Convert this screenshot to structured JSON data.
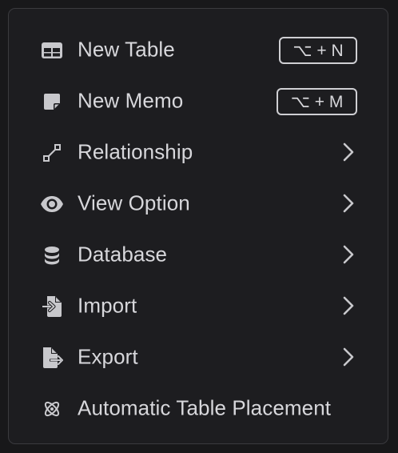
{
  "menu": {
    "items": [
      {
        "label": "New Table",
        "icon": "table-icon",
        "shortcut": "⌥ + N",
        "submenu": false
      },
      {
        "label": "New Memo",
        "icon": "memo-icon",
        "shortcut": "⌥ + M",
        "submenu": false
      },
      {
        "label": "Relationship",
        "icon": "relationship-icon",
        "shortcut": "",
        "submenu": true
      },
      {
        "label": "View Option",
        "icon": "eye-icon",
        "shortcut": "",
        "submenu": true
      },
      {
        "label": "Database",
        "icon": "database-icon",
        "shortcut": "",
        "submenu": true
      },
      {
        "label": "Import",
        "icon": "import-icon",
        "shortcut": "",
        "submenu": true
      },
      {
        "label": "Export",
        "icon": "export-icon",
        "shortcut": "",
        "submenu": true
      },
      {
        "label": "Automatic Table Placement",
        "icon": "atom-icon",
        "shortcut": "",
        "submenu": false
      }
    ]
  },
  "colors": {
    "background": "#1d1d20",
    "border": "#3a3a3e",
    "text": "#d7d7db",
    "icon": "#c8c8cc"
  }
}
